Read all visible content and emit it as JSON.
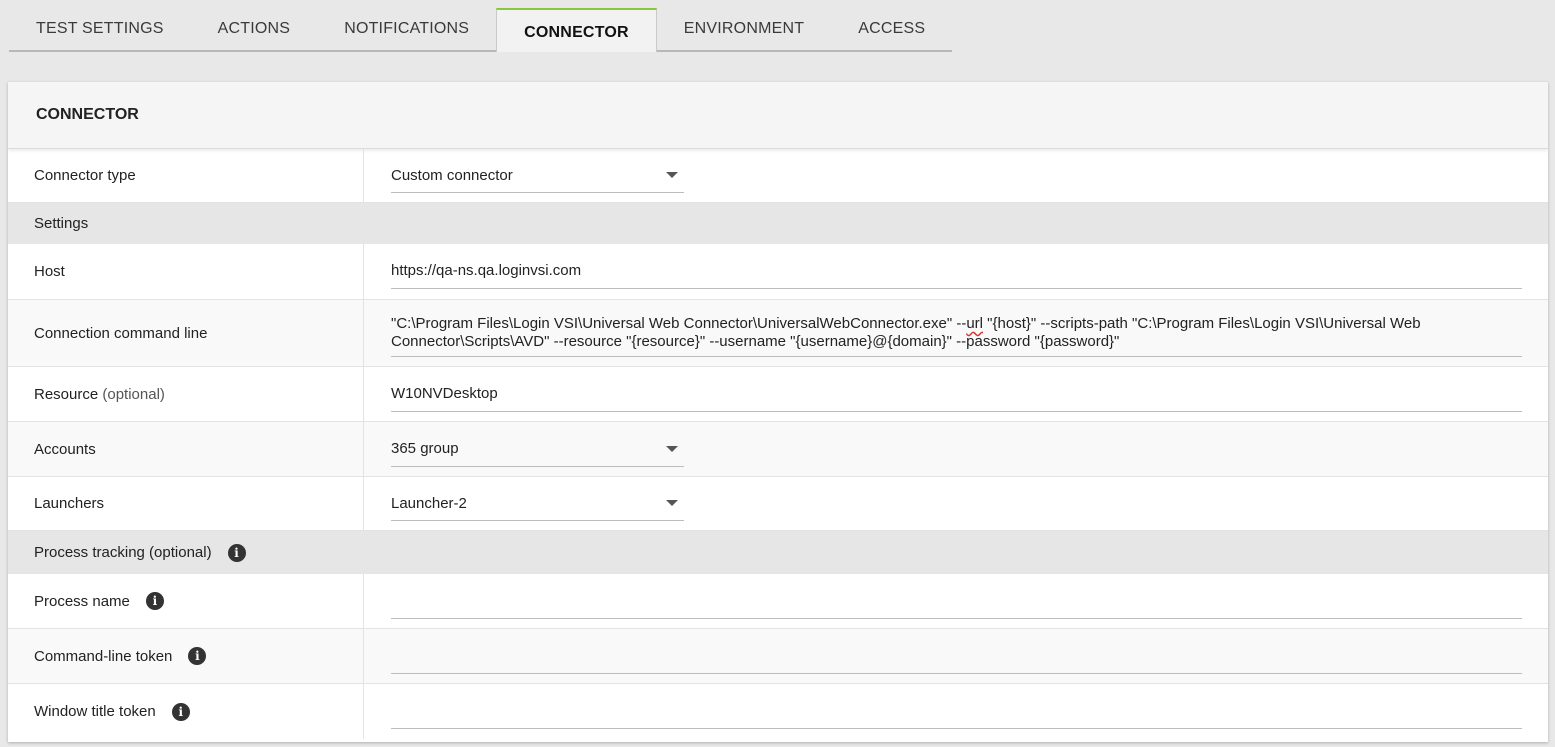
{
  "tabs": [
    {
      "label": "TEST SETTINGS",
      "active": false
    },
    {
      "label": "ACTIONS",
      "active": false
    },
    {
      "label": "NOTIFICATIONS",
      "active": false
    },
    {
      "label": "CONNECTOR",
      "active": true
    },
    {
      "label": "ENVIRONMENT",
      "active": false
    },
    {
      "label": "ACCESS",
      "active": false
    }
  ],
  "panel": {
    "title": "CONNECTOR",
    "connector_type": {
      "label": "Connector type",
      "value": "Custom connector"
    },
    "settings_section": "Settings",
    "host": {
      "label": "Host",
      "value": "https://qa-ns.qa.loginvsi.com"
    },
    "command_line": {
      "label": "Connection command line",
      "value_part1": "\"C:\\Program Files\\Login VSI\\Universal Web Connector\\UniversalWebConnector.exe\" --",
      "value_url": "url",
      "value_part2": " \"{host}\" --scripts-path \"C:\\Program Files\\Login VSI\\Universal Web Connector\\Scripts\\AVD\" --resource \"{resource}\" --username \"{username}@{domain}\" --password \"{password}\""
    },
    "resource": {
      "label": "Resource",
      "optional": "(optional)",
      "value": "W10NVDesktop"
    },
    "accounts": {
      "label": "Accounts",
      "value": "365 group"
    },
    "launchers": {
      "label": "Launchers",
      "value": "Launcher-2"
    },
    "process_section": "Process tracking (optional)",
    "process_name": {
      "label": "Process name",
      "value": ""
    },
    "cmd_token": {
      "label": "Command-line token",
      "value": ""
    },
    "window_token": {
      "label": "Window title token",
      "value": ""
    }
  },
  "icons": {
    "info": "info-icon",
    "dropdown": "chevron-down-icon"
  },
  "colors": {
    "active_tab_accent": "#8cc63f",
    "section_bg": "#e6e6e6"
  }
}
